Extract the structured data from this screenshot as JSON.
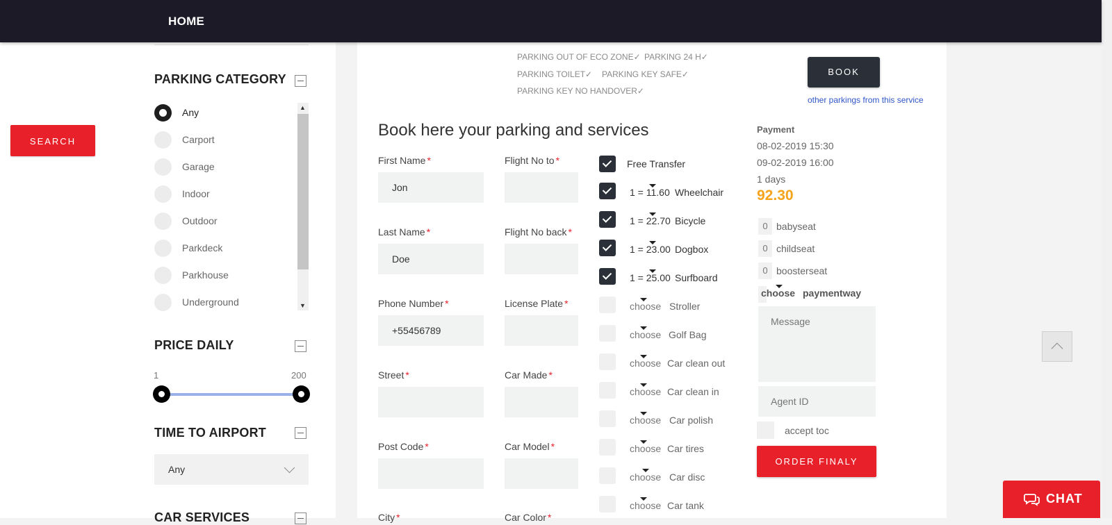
{
  "nav": {
    "home": "HOME"
  },
  "sidebar": {
    "search_label": "SEARCH",
    "parking_category": {
      "title": "PARKING CATEGORY",
      "options": [
        "Any",
        "Carport",
        "Garage",
        "Indoor",
        "Outdoor",
        "Parkdeck",
        "Parkhouse",
        "Underground"
      ],
      "selected": "Any"
    },
    "price_daily": {
      "title": "PRICE DAILY",
      "min": "1",
      "max": "200"
    },
    "time_to_airport": {
      "title": "TIME TO AIRPORT",
      "value": "Any"
    },
    "car_services": {
      "title": "CAR SERVICES"
    }
  },
  "parking": {
    "amenities": [
      "PARKING OUT OF ECO ZONE✓",
      "PARKING 24 H✓",
      "PARKING TOILET✓",
      "PARKING KEY SAFE✓",
      "PARKING KEY NO HANDOVER✓"
    ],
    "book_label": "BOOK",
    "other_link": "other parkings from this service"
  },
  "form": {
    "title": "Book here your parking and services",
    "fields": {
      "first_name": {
        "label": "First Name",
        "value": "Jon"
      },
      "flight_no_to": {
        "label": "Flight No to",
        "value": ""
      },
      "last_name": {
        "label": "Last Name",
        "value": "Doe"
      },
      "flight_no_back": {
        "label": "Flight No back",
        "value": ""
      },
      "phone": {
        "label": "Phone Number",
        "value": "+55456789"
      },
      "license_plate": {
        "label": "License Plate",
        "value": ""
      },
      "street": {
        "label": "Street",
        "value": ""
      },
      "car_made": {
        "label": "Car Made",
        "value": ""
      },
      "post_code": {
        "label": "Post Code",
        "value": ""
      },
      "car_model": {
        "label": "Car Model",
        "value": ""
      },
      "city": {
        "label": "City",
        "value": ""
      },
      "car_color": {
        "label": "Car Color",
        "value": ""
      }
    },
    "required_mark": "*"
  },
  "services": {
    "free_transfer": "Free Transfer",
    "items": [
      {
        "qty": "1 = 11.60",
        "name": "Wheelchair",
        "checked": true
      },
      {
        "qty": "1 = 22.70",
        "name": "Bicycle",
        "checked": true
      },
      {
        "qty": "1 = 23.00",
        "name": "Dogbox",
        "checked": true
      },
      {
        "qty": "1 = 25.00",
        "name": "Surfboard",
        "checked": true
      },
      {
        "qty": "choose",
        "name": "Stroller",
        "checked": false
      },
      {
        "qty": "choose",
        "name": "Golf Bag",
        "checked": false
      },
      {
        "qty": "choose",
        "name": "Car clean out",
        "checked": false
      },
      {
        "qty": "choose",
        "name": "Car clean in",
        "checked": false
      },
      {
        "qty": "choose",
        "name": "Car polish",
        "checked": false
      },
      {
        "qty": "choose",
        "name": "Car tires",
        "checked": false
      },
      {
        "qty": "choose",
        "name": "Car disc",
        "checked": false
      },
      {
        "qty": "choose",
        "name": "Car tank",
        "checked": false
      }
    ]
  },
  "payment": {
    "title": "Payment",
    "start": "08-02-2019 15:30",
    "end": "09-02-2019 16:00",
    "days": "1 days",
    "total": "92.30",
    "seats": [
      {
        "count": "0",
        "label": "babyseat"
      },
      {
        "count": "0",
        "label": "childseat"
      },
      {
        "count": "0",
        "label": "boosterseat"
      }
    ],
    "paymentway_choose": "choose",
    "paymentway_label": "paymentway",
    "message_placeholder": "Message",
    "agent_placeholder": "Agent ID",
    "accept_toc": "accept toc",
    "order_label": "ORDER FINALY"
  },
  "chat": {
    "label": "CHAT"
  },
  "colors": {
    "accent_red": "#e8202a",
    "dark": "#1b1a26",
    "total_orange": "#f6a31c"
  }
}
